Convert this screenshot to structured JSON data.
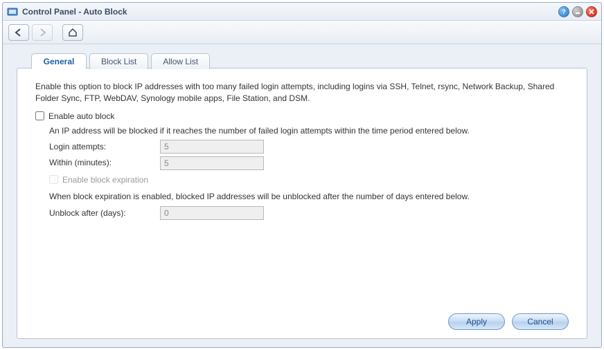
{
  "window": {
    "title": "Control Panel - Auto Block"
  },
  "tabs": [
    {
      "label": "General",
      "active": true
    },
    {
      "label": "Block List",
      "active": false
    },
    {
      "label": "Allow List",
      "active": false
    }
  ],
  "content": {
    "description": "Enable this option to block IP addresses with too many failed login attempts, including logins via SSH, Telnet, rsync, Network Backup, Shared Folder Sync, FTP, WebDAV, Synology mobile apps, File Station, and DSM.",
    "enable_auto_block": {
      "label": "Enable auto block",
      "checked": false,
      "sub_desc": "An IP address will be blocked if it reaches the number of failed login attempts within the time period entered below."
    },
    "login_attempts": {
      "label": "Login attempts:",
      "value": "5",
      "disabled": true
    },
    "within_minutes": {
      "label": "Within (minutes):",
      "value": "5",
      "disabled": true
    },
    "enable_block_expiration": {
      "label": "Enable block expiration",
      "checked": false,
      "disabled": true,
      "sub_desc": "When block expiration is enabled, blocked IP addresses will be unblocked after the number of days entered below."
    },
    "unblock_after": {
      "label": "Unblock after (days):",
      "value": "0",
      "disabled": true
    }
  },
  "buttons": {
    "apply": "Apply",
    "cancel": "Cancel"
  }
}
